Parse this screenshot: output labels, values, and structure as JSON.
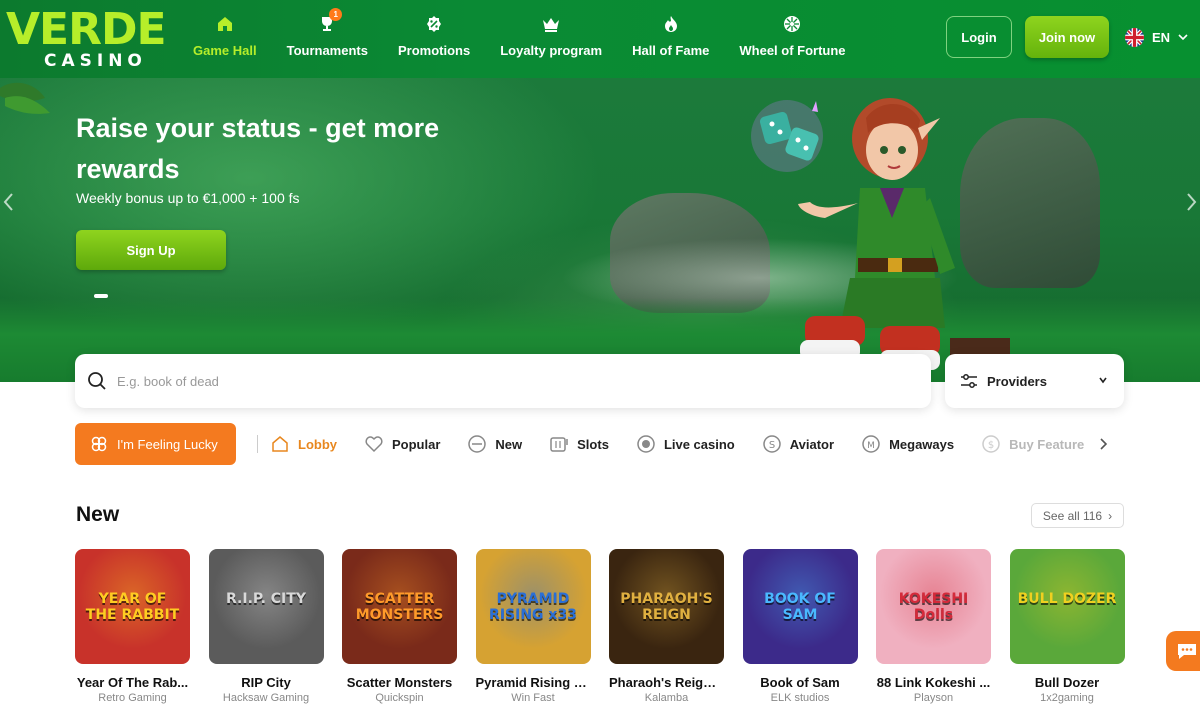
{
  "brand": {
    "name": "VERDE",
    "sub": "CASINO"
  },
  "nav": {
    "items": [
      {
        "label": "Game Hall",
        "icon": "home-icon",
        "active": true
      },
      {
        "label": "Tournaments",
        "icon": "trophy-icon",
        "badge": "1"
      },
      {
        "label": "Promotions",
        "icon": "percent-badge-icon"
      },
      {
        "label": "Loyalty program",
        "icon": "crown-icon"
      },
      {
        "label": "Hall of Fame",
        "icon": "flame-icon"
      },
      {
        "label": "Wheel of Fortune",
        "icon": "wheel-icon"
      }
    ],
    "login_label": "Login",
    "join_label": "Join now",
    "language": "EN"
  },
  "hero": {
    "title": "Raise your status - get more rewards",
    "subtitle": "Weekly bonus up to €1,000 + 100 fs",
    "cta_label": "Sign Up"
  },
  "search": {
    "placeholder": "E.g. book of dead",
    "value": "",
    "providers_label": "Providers"
  },
  "categories": {
    "lucky_label": "I'm Feeling Lucky",
    "items": [
      {
        "label": "Lobby",
        "icon": "lobby-home-icon",
        "active": true
      },
      {
        "label": "Popular",
        "icon": "heart-icon"
      },
      {
        "label": "New",
        "icon": "new-icon"
      },
      {
        "label": "Slots",
        "icon": "slots-icon"
      },
      {
        "label": "Live casino",
        "icon": "live-icon"
      },
      {
        "label": "Aviator",
        "icon": "aviator-icon"
      },
      {
        "label": "Megaways",
        "icon": "megaways-icon"
      },
      {
        "label": "Buy Feature",
        "icon": "buy-feature-icon"
      }
    ]
  },
  "new_section": {
    "title": "New",
    "see_all_label": "See all 116",
    "games": [
      {
        "name": "Year Of The Rab...",
        "provider": "Retro Gaming",
        "thumb_text": "YEAR OF THE RABBIT",
        "bg": "#c8322a",
        "accent": "#ffcc22"
      },
      {
        "name": "RIP City",
        "provider": "Hacksaw Gaming",
        "thumb_text": "R.I.P. CITY",
        "bg": "#5b5b5b",
        "accent": "#d9d9d9"
      },
      {
        "name": "Scatter Monsters",
        "provider": "Quickspin",
        "thumb_text": "SCATTER MONSTERS",
        "bg": "#7a2a1a",
        "accent": "#ff9a2a"
      },
      {
        "name": "Pyramid Rising x...",
        "provider": "Win Fast",
        "thumb_text": "PYRAMID RISING x33",
        "bg": "#d6a232",
        "accent": "#2a6fd6"
      },
      {
        "name": "Pharaoh's Reign ...",
        "provider": "Kalamba",
        "thumb_text": "PHARAOH'S REIGN",
        "bg": "#3a2510",
        "accent": "#e0b040"
      },
      {
        "name": "Book of Sam",
        "provider": "ELK studios",
        "thumb_text": "BOOK OF SAM",
        "bg": "#3c2a8a",
        "accent": "#4ab8ff"
      },
      {
        "name": "88 Link Kokeshi ...",
        "provider": "Playson",
        "thumb_text": "KOKESHI Dolls",
        "bg": "#f0b0c0",
        "accent": "#d42a3a"
      },
      {
        "name": "Bull Dozer",
        "provider": "1x2gaming",
        "thumb_text": "BULL DOZER",
        "bg": "#5aa83a",
        "accent": "#f0d020"
      }
    ]
  },
  "colors": {
    "brand_green": "#0a8a34",
    "lime": "#b6ee2a",
    "orange": "#f47a1f",
    "active_category": "#e8871e"
  }
}
